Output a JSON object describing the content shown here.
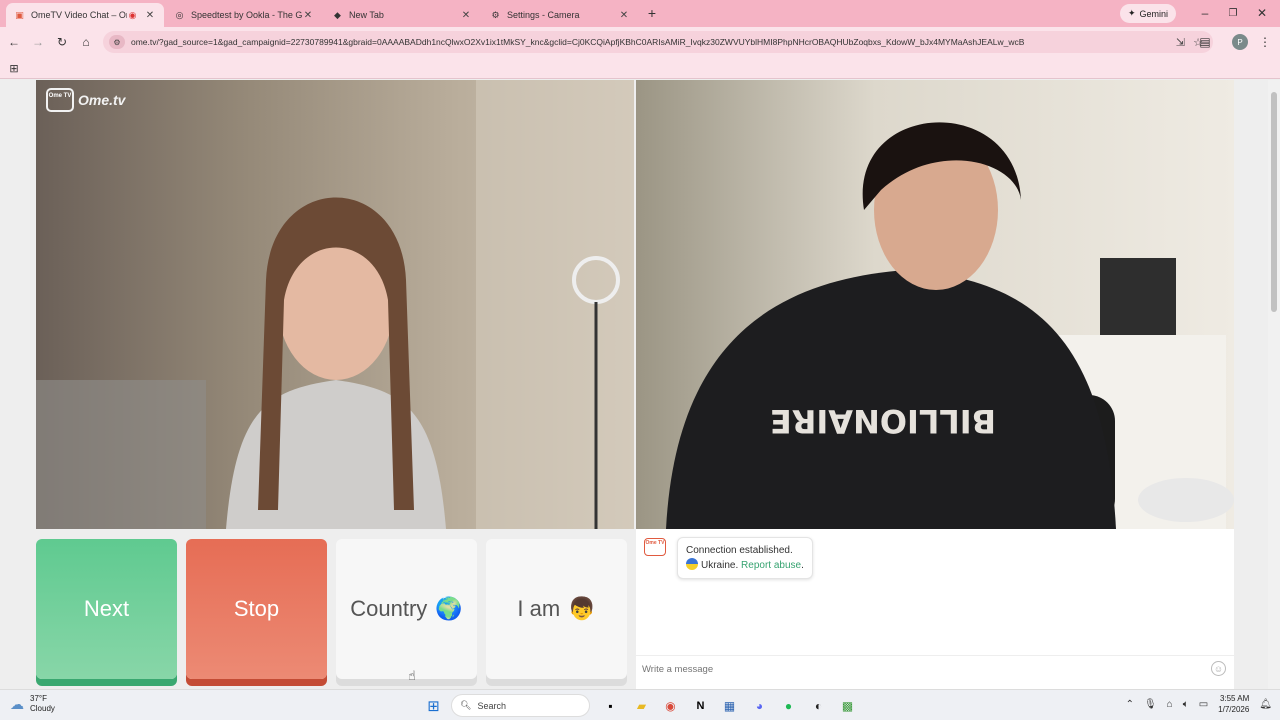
{
  "browser": {
    "tabs": [
      {
        "title": "OmeTV Video Chat – Ome",
        "icon": "ometv-favicon",
        "active": true
      },
      {
        "title": "Speedtest by Ookla - The Globa",
        "icon": "speedtest-favicon",
        "active": false
      },
      {
        "title": "New Tab",
        "icon": "newtab-favicon",
        "active": false
      },
      {
        "title": "Settings - Camera",
        "icon": "settings-gear-icon",
        "active": false
      }
    ],
    "new_tab_label": "+",
    "gemini_label": "Gemini",
    "url": "ome.tv/?gad_source=1&gad_campaignid=22730789941&gbraid=0AAAABADdh1ncQlwxO2Xv1ix1tMkSY_knc&gclid=Cj0KCQiApfjKBhC0ARIsAMiR_Ivqkz30ZWVUYblHMI8PhpNHcrOBAQHUbZoqbxs_KdowW_bJx4MYMaAshJEALw_wcB",
    "profile_initial": "P"
  },
  "app": {
    "brand": "Ome.tv",
    "logo_small_text": "Ome TV",
    "buttons": {
      "next": "Next",
      "stop": "Stop",
      "country": "Country",
      "country_icon": "🌍",
      "iam": "I am",
      "iam_icon": "👦"
    },
    "chat": {
      "logo_text": "Ome TV",
      "status": "Connection established.",
      "country": "Ukraine.",
      "report_link": "Report abuse",
      "report_suffix": ".",
      "placeholder": "Write a message"
    }
  },
  "taskbar": {
    "weather_temp": "37°F",
    "weather_desc": "Cloudy",
    "search_placeholder": "Search",
    "time": "3:55 AM",
    "date": "1/7/2026"
  },
  "colors": {
    "tab_bar": "#f5b3c4",
    "next_button": "#5fca90",
    "stop_button": "#e66d55",
    "report_link": "#36a370"
  }
}
